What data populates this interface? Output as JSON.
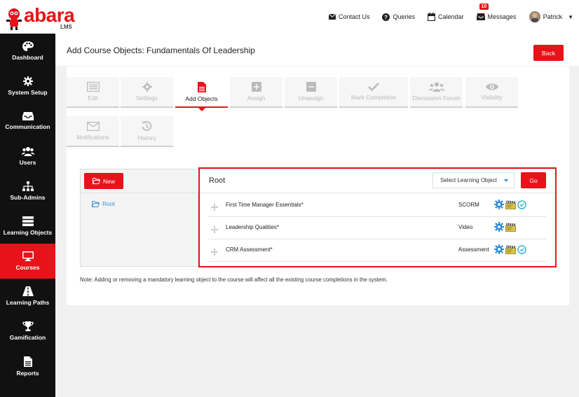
{
  "brand": {
    "logo_text": "abara",
    "logo_sub": "LMS"
  },
  "topnav": {
    "contact": "Contact Us",
    "queries": "Queries",
    "calendar": "Calendar",
    "messages": "Messages",
    "messages_count": "10",
    "user": "Patrick"
  },
  "sidebar": {
    "items": [
      {
        "label": "Dashboard",
        "icon": "palette-icon"
      },
      {
        "label": "System Setup",
        "icon": "gear-icon"
      },
      {
        "label": "Communication",
        "icon": "inbox-icon"
      },
      {
        "label": "Users",
        "icon": "users-icon"
      },
      {
        "label": "Sub-Admins",
        "icon": "sitemap-icon"
      },
      {
        "label": "Learning Objects",
        "icon": "stack-icon"
      },
      {
        "label": "Courses",
        "icon": "monitor-icon"
      },
      {
        "label": "Learning Paths",
        "icon": "road-icon"
      },
      {
        "label": "Gamification",
        "icon": "trophy-icon"
      },
      {
        "label": "Reports",
        "icon": "file-icon"
      }
    ],
    "active": "Courses"
  },
  "header": {
    "title": "Add Course Objects: Fundamentals Of Leadership",
    "back_label": "Back"
  },
  "tabs": [
    {
      "label": "Edit"
    },
    {
      "label": "Settings"
    },
    {
      "label": "Add Objects"
    },
    {
      "label": "Assign"
    },
    {
      "label": "Unassign"
    },
    {
      "label": "Mark Completion"
    },
    {
      "label": "Discussion Forum"
    },
    {
      "label": "Visibility"
    },
    {
      "label": "Notifications"
    },
    {
      "label": "History"
    }
  ],
  "tree": {
    "new_label": "New",
    "root_link": "Root"
  },
  "objects": {
    "title": "Root",
    "select_placeholder": "Select Learning Object",
    "go_label": "Go",
    "rows": [
      {
        "name": "First Time Manager Essentials*",
        "type": "SCORM"
      },
      {
        "name": "Leadership Qualities*",
        "type": "Video"
      },
      {
        "name": "CRM Assessment*",
        "type": "Assessment"
      }
    ]
  },
  "note": "Note: Adding or removing a mandatory learning object to the course will affect all the existing course completions in the system.",
  "colors": {
    "accent": "#e8131a",
    "sidebar_bg": "#111111",
    "link": "#3a8fd6"
  }
}
